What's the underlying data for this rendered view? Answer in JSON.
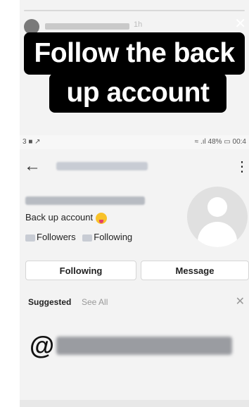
{
  "story": {
    "time": "1h",
    "close_icon": "✕",
    "caption_line1": "Follow the back",
    "caption_line2": "up account"
  },
  "statusbar": {
    "left": "3 ■ ↗",
    "right": "≈ .ıl 48% ▭ 00:4"
  },
  "profile": {
    "back_icon": "←",
    "menu_icon": "⋮",
    "bio": "Back up account",
    "followers_label": "Followers",
    "following_label": "Following"
  },
  "actions": {
    "following_button": "Following",
    "message_button": "Message"
  },
  "suggested": {
    "title": "Suggested",
    "see_all": "See All",
    "close_icon": "✕"
  },
  "mention": {
    "at": "@"
  }
}
